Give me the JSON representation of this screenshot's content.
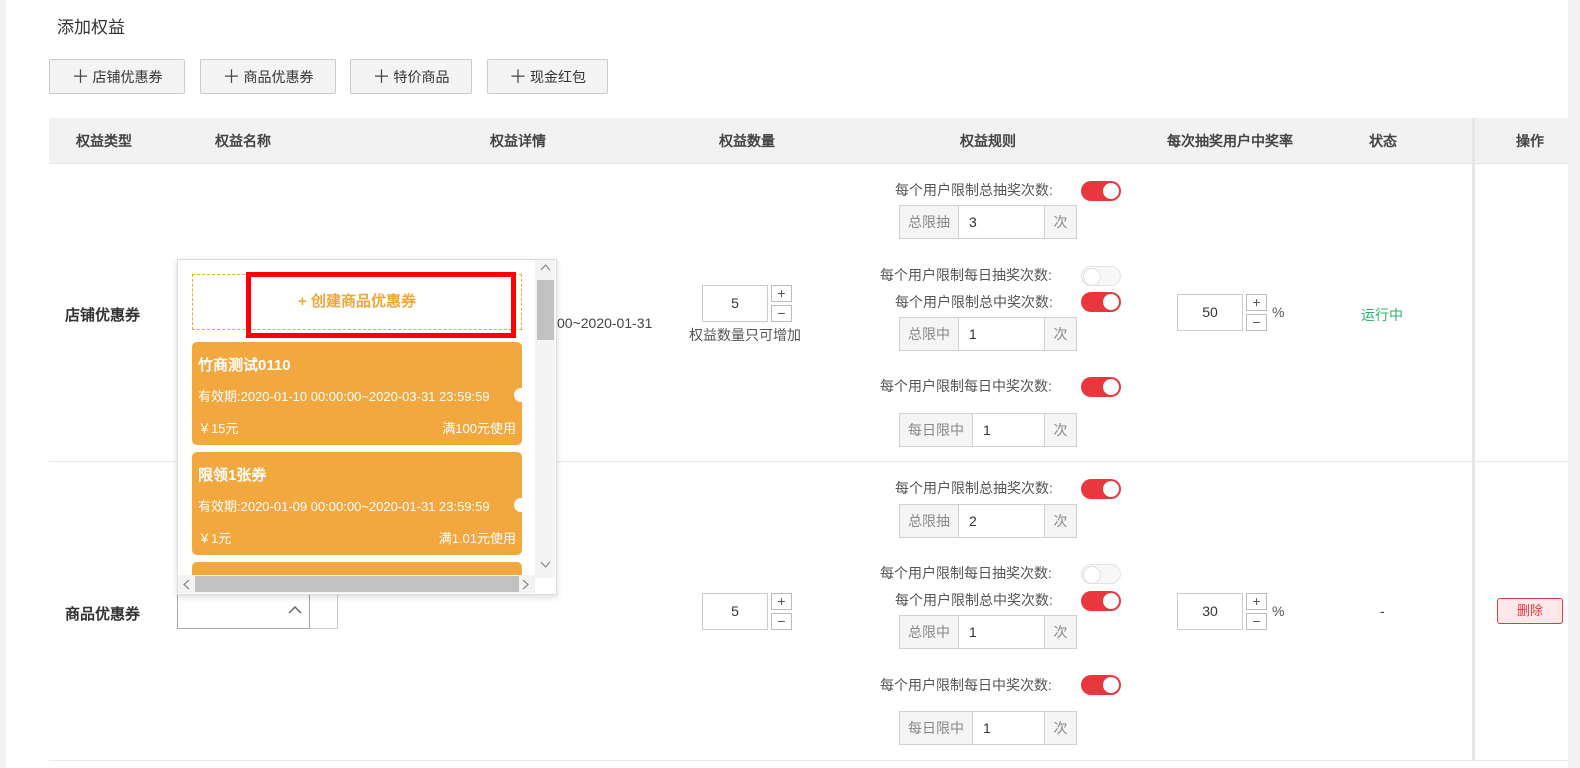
{
  "page": {
    "title": "添加权益"
  },
  "add_buttons": [
    "店铺优惠券",
    "商品优惠券",
    "特价商品",
    "现金红包"
  ],
  "table": {
    "headers": [
      "权益类型",
      "权益名称",
      "权益详情",
      "权益数量",
      "权益规则",
      "每次抽奖用户中奖率",
      "状态",
      "操作"
    ]
  },
  "rows": [
    {
      "type": "店铺优惠券",
      "detail_partial": "00~2020-01-31",
      "quantity": "5",
      "quantity_note": "权益数量只可增加",
      "rules": {
        "total_draw_label": "每个用户限制总抽奖次数:",
        "total_draw_prefix": "总限抽",
        "total_draw_value": "3",
        "daily_draw_label": "每个用户限制每日抽奖次数:",
        "total_win_label": "每个用户限制总中奖次数:",
        "total_win_prefix": "总限中",
        "total_win_value": "1",
        "daily_win_label": "每个用户限制每日中奖次数:",
        "daily_win_prefix": "每日限中",
        "daily_win_value": "1",
        "unit": "次"
      },
      "rate": "50",
      "status": "运行中"
    },
    {
      "type": "商品优惠券",
      "quantity": "5",
      "rules": {
        "total_draw_label": "每个用户限制总抽奖次数:",
        "total_draw_prefix": "总限抽",
        "total_draw_value": "2",
        "daily_draw_label": "每个用户限制每日抽奖次数:",
        "total_win_label": "每个用户限制总中奖次数:",
        "total_win_prefix": "总限中",
        "total_win_value": "1",
        "daily_win_label": "每个用户限制每日中奖次数:",
        "daily_win_prefix": "每日限中",
        "daily_win_value": "1",
        "unit": "次"
      },
      "rate": "30",
      "status": "-",
      "action": "删除"
    }
  ],
  "stepper": {
    "plus": "+",
    "minus": "−"
  },
  "percent": "%",
  "dropdown": {
    "create_label": "+ 创建商品优惠券",
    "coupons": [
      {
        "name": "竹商测试0110",
        "validity": "有效期:2020-01-10 00:00:00~2020-03-31 23:59:59",
        "amount": "￥15元",
        "condition": "满100元使用"
      },
      {
        "name": "限领1张券",
        "validity": "有效期:2020-01-09 00:00:00~2020-01-31 23:59:59",
        "amount": "￥1元",
        "condition": "满1.01元使用"
      }
    ]
  },
  "colors": {
    "accent_red": "#e8383d",
    "coupon_orange": "#f2a83e",
    "status_green": "#2db36b",
    "highlight_box": "#ff0000"
  }
}
